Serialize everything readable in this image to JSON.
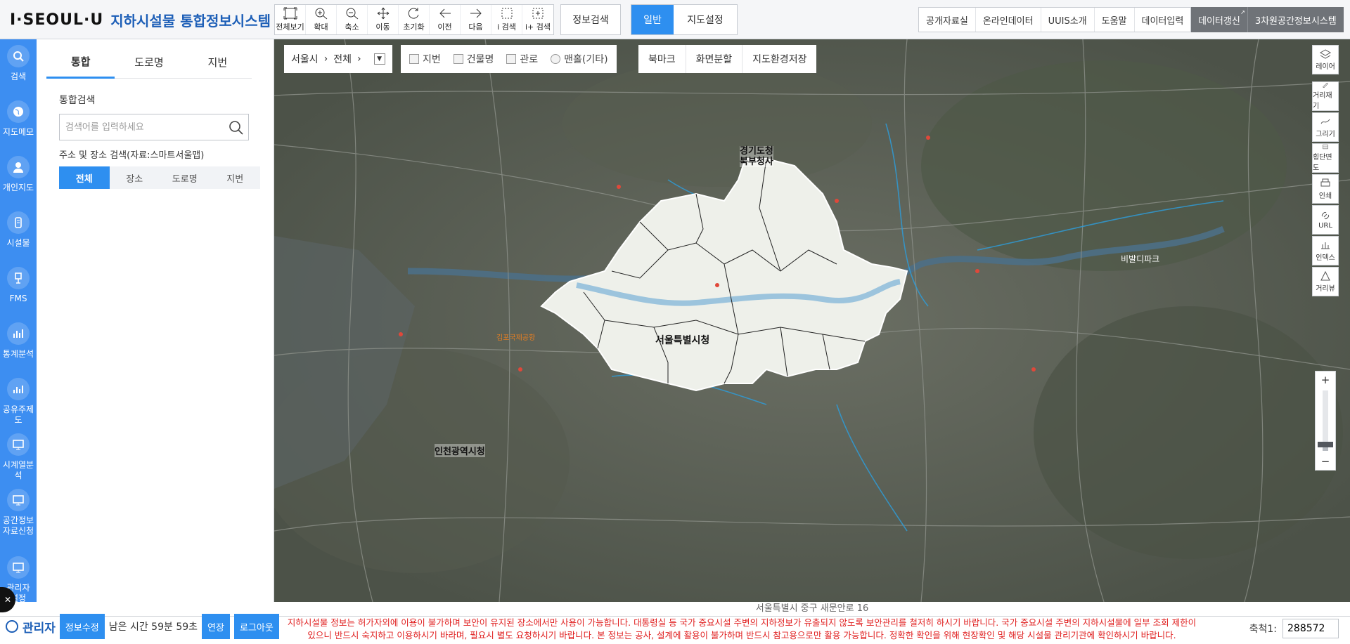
{
  "header": {
    "brand": "I·SEOUL·U",
    "title": "지하시설물 통합정보시스템",
    "tools": [
      "전체보기",
      "확대",
      "축소",
      "이동",
      "초기화",
      "이전",
      "다음",
      "i 검색",
      "i+ 검색"
    ],
    "info_search": "정보검색",
    "modes": [
      "일반",
      "지도설정"
    ],
    "links": [
      "공개자료실",
      "온라인데이터",
      "UUIS소개",
      "도움말",
      "데이터입력"
    ],
    "dark_links": [
      "데이터갱신",
      "3차원공간정보시스템"
    ]
  },
  "leftnav": [
    "검색",
    "지도메모",
    "개인지도",
    "시설물",
    "FMS",
    "통계분석",
    "공유주제도",
    "시계열분석",
    "공간정보\n자료신청",
    "관리자\n설정"
  ],
  "panel": {
    "tabs": [
      "통합",
      "도로명",
      "지번"
    ],
    "section_title": "통합검색",
    "search_placeholder": "검색어를 입력하세요",
    "addr_title": "주소 및 장소 검색(자료:스마트서울맵)",
    "subtabs": [
      "전체",
      "장소",
      "도로명",
      "지번"
    ]
  },
  "map": {
    "breadcrumb_city": "서울시",
    "breadcrumb_scope": "전체",
    "layers": [
      "지번",
      "건물명",
      "관로",
      "맨홀(기타)"
    ],
    "buttons": [
      "북마크",
      "화면분할",
      "지도환경저장"
    ],
    "right_tools": [
      "레이어",
      "거리재기",
      "그리기",
      "횡단면도",
      "인쇄",
      "URL",
      "인덱스",
      "거리뷰"
    ],
    "labels": {
      "gyeonggi": "경기도청\n북부청사",
      "seoul": "서울특별시청",
      "incheon": "인천광역시청",
      "bimal": "비발디파크",
      "gimpo": "김포국제공항"
    },
    "zoom_plus": "+",
    "zoom_minus": "−",
    "zoom_level": 0.1
  },
  "footer": {
    "map_address": "서울특별시 중구 새문안로 16",
    "user": "관리자",
    "edit_info": "정보수정",
    "remaining_label": "남은 시간 59분 59초",
    "extend": "연장",
    "logout": "로그아웃",
    "notice_line1": "지하시설물 정보는 허가자외에 이용이 불가하며 보안이 유지된 장소에서만 사용이 가능합니다. 대통령실 등 국가 중요시설 주변의 지하정보가 유출되지 않도록 보안관리를 철저히 하시기 바랍니다. 국가 중요시설 주변의 지하시설물에 일부 조회 제한이",
    "notice_line2": "있으니 반드시 숙지하고 이용하시기 바라며, 필요시 별도 요청하시기 바랍니다. 본 정보는 공사, 설계에 활용이 불가하며 반드시 참고용으로만 활용 가능합니다. 정확한 확인을 위해 현장확인 및 해당 시설물 관리기관에 확인하시기 바랍니다.",
    "scale_label": "축척1:",
    "scale_value": "288572"
  }
}
